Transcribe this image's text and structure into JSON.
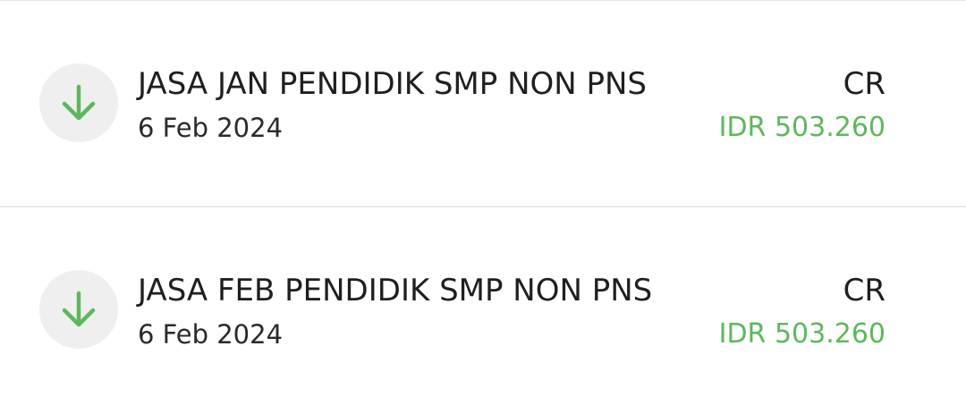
{
  "colors": {
    "credit_green": "#5cb85c",
    "icon_bg": "#efefef"
  },
  "transactions": [
    {
      "icon": "arrow-down-icon",
      "title": "JASA JAN PENDIDIK SMP NON PNS",
      "date": "6 Feb 2024",
      "type": "CR",
      "amount": "IDR 503.260"
    },
    {
      "icon": "arrow-down-icon",
      "title": "JASA FEB PENDIDIK SMP NON PNS",
      "date": "6 Feb 2024",
      "type": "CR",
      "amount": "IDR 503.260"
    }
  ]
}
